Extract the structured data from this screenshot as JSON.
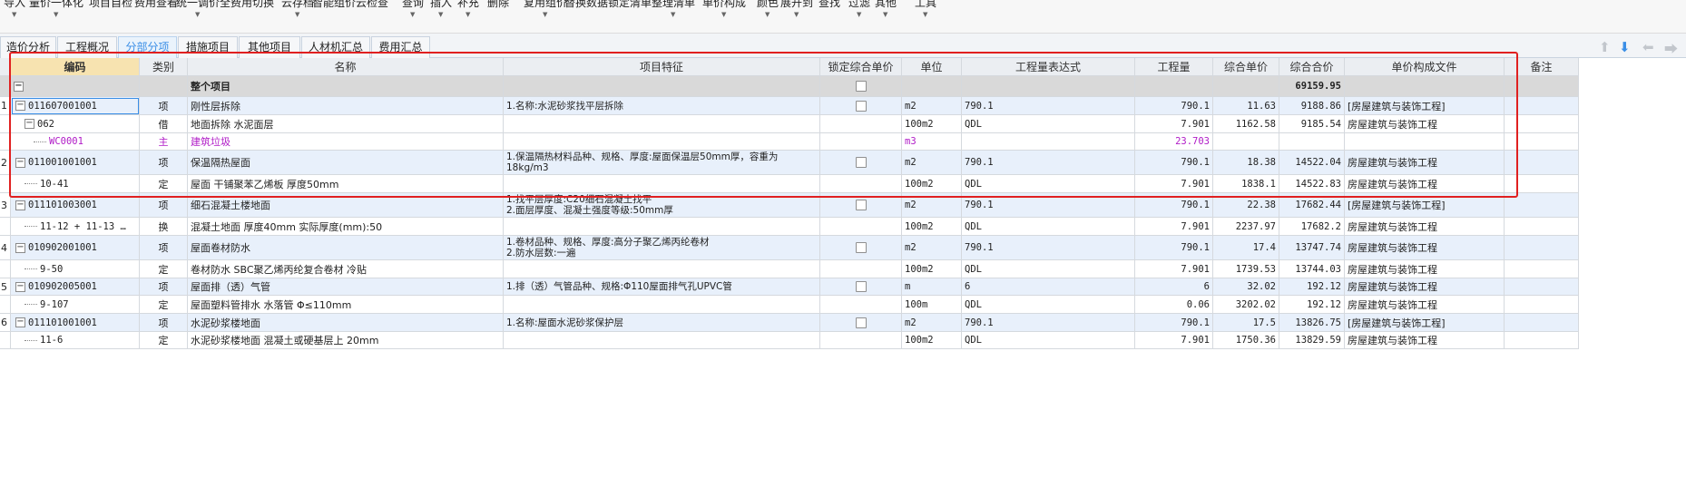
{
  "toolbar": [
    {
      "label": "导入",
      "arrow": true
    },
    {
      "label": "量价一体化",
      "arrow": true
    },
    {
      "label": "项目自检",
      "arrow": false
    },
    {
      "label": "费用查看",
      "arrow": false
    },
    {
      "label": "统一调价",
      "arrow": true
    },
    {
      "label": "全费用切换",
      "arrow": false
    },
    {
      "label": "云存档",
      "arrow": true
    },
    {
      "label": "智能组价",
      "arrow": false
    },
    {
      "label": "云检查",
      "arrow": false
    },
    {
      "label": "查询",
      "arrow": true
    },
    {
      "label": "插入",
      "arrow": true
    },
    {
      "label": "补充",
      "arrow": true
    },
    {
      "label": "删除",
      "arrow": false
    },
    {
      "label": "复用组价",
      "arrow": true
    },
    {
      "label": "替换数据",
      "arrow": false
    },
    {
      "label": "锁定清单",
      "arrow": false
    },
    {
      "label": "整理清单",
      "arrow": true
    },
    {
      "label": "单价构成",
      "arrow": true
    },
    {
      "label": "颜色",
      "arrow": true
    },
    {
      "label": "展开到",
      "arrow": true
    },
    {
      "label": "查找",
      "arrow": false
    },
    {
      "label": "过滤",
      "arrow": true
    },
    {
      "label": "其他",
      "arrow": true
    },
    {
      "label": "工具",
      "arrow": true
    }
  ],
  "tabs": [
    {
      "label": "造价分析",
      "active": false
    },
    {
      "label": "工程概况",
      "active": false
    },
    {
      "label": "分部分项",
      "active": true
    },
    {
      "label": "措施项目",
      "active": false
    },
    {
      "label": "其他项目",
      "active": false
    },
    {
      "label": "人材机汇总",
      "active": false
    },
    {
      "label": "费用汇总",
      "active": false
    }
  ],
  "nav_icons": [
    "arrow-up-icon",
    "arrow-down-icon",
    "arrow-left-icon",
    "arrow-right-icon"
  ],
  "columns": [
    "编码",
    "类别",
    "名称",
    "项目特征",
    "锁定综合单价",
    "单位",
    "工程量表达式",
    "工程量",
    "综合单价",
    "综合合价",
    "单价构成文件",
    "备注"
  ],
  "whole_project": {
    "name": "整个项目",
    "total": "69159.95"
  },
  "rows": [
    {
      "num": "1",
      "level": 0,
      "type": "q",
      "code": "011607001001",
      "category": "项",
      "name": "刚性层拆除",
      "features": [
        "1.名称:水泥砂浆找平层拆除"
      ],
      "lock": true,
      "unit": "m2",
      "expr": "790.1",
      "qty": "790.1",
      "unit_price": "11.63",
      "total": "9188.86",
      "file": "[房屋建筑与装饰工程]"
    },
    {
      "num": "",
      "level": 1,
      "type": "s",
      "code": "062",
      "category": "借",
      "name": "地面拆除 水泥面层",
      "features": [],
      "lock": false,
      "unit": "100m2",
      "expr": "QDL",
      "qty": "7.901",
      "unit_price": "1162.58",
      "total": "9185.54",
      "file": "房屋建筑与装饰工程"
    },
    {
      "num": "",
      "level": 2,
      "type": "m",
      "code": "WC0001",
      "category": "主",
      "name": "建筑垃圾",
      "features": [],
      "lock": false,
      "unit": "m3",
      "expr": "",
      "qty": "23.703",
      "unit_price": "",
      "total": "",
      "file": ""
    },
    {
      "num": "2",
      "level": 0,
      "type": "q",
      "code": "011001001001",
      "category": "项",
      "name": "保温隔热屋面",
      "features": [
        "1.保温隔热材料品种、规格、厚度:屋面保温层50mm厚，容重为18kg/m3"
      ],
      "lock": true,
      "unit": "m2",
      "expr": "790.1",
      "qty": "790.1",
      "unit_price": "18.38",
      "total": "14522.04",
      "file": "房屋建筑与装饰工程"
    },
    {
      "num": "",
      "level": 1,
      "type": "s",
      "code": "10-41",
      "category": "定",
      "name": "屋面 干铺聚苯乙烯板 厚度50mm",
      "features": [],
      "lock": false,
      "unit": "100m2",
      "expr": "QDL",
      "qty": "7.901",
      "unit_price": "1838.1",
      "total": "14522.83",
      "file": "房屋建筑与装饰工程"
    },
    {
      "num": "3",
      "level": 0,
      "type": "q",
      "code": "011101003001",
      "category": "项",
      "name": "细石混凝土楼地面",
      "features": [
        "1.找平层厚度:C20细石混凝土找平",
        "2.面层厚度、混凝土强度等级:50mm厚"
      ],
      "lock": true,
      "unit": "m2",
      "expr": "790.1",
      "qty": "790.1",
      "unit_price": "22.38",
      "total": "17682.44",
      "file": "[房屋建筑与装饰工程]"
    },
    {
      "num": "",
      "level": 1,
      "type": "s",
      "code": "11-12 + 11-13 …",
      "category": "换",
      "name": "混凝土地面 厚度40mm  实际厚度(mm):50",
      "features": [],
      "lock": false,
      "unit": "100m2",
      "expr": "QDL",
      "qty": "7.901",
      "unit_price": "2237.97",
      "total": "17682.2",
      "file": "房屋建筑与装饰工程"
    },
    {
      "num": "4",
      "level": 0,
      "type": "q",
      "code": "010902001001",
      "category": "项",
      "name": "屋面卷材防水",
      "features": [
        "1.卷材品种、规格、厚度:高分子聚乙烯丙纶卷材",
        "2.防水层数:一遍"
      ],
      "lock": true,
      "unit": "m2",
      "expr": "790.1",
      "qty": "790.1",
      "unit_price": "17.4",
      "total": "13747.74",
      "file": "房屋建筑与装饰工程"
    },
    {
      "num": "",
      "level": 1,
      "type": "s",
      "code": "9-50",
      "category": "定",
      "name": "卷材防水 SBC聚乙烯丙纶复合卷材 冷贴",
      "features": [],
      "lock": false,
      "unit": "100m2",
      "expr": "QDL",
      "qty": "7.901",
      "unit_price": "1739.53",
      "total": "13744.03",
      "file": "房屋建筑与装饰工程"
    },
    {
      "num": "5",
      "level": 0,
      "type": "q",
      "code": "010902005001",
      "category": "项",
      "name": "屋面排（透）气管",
      "features": [
        "1.排（透）气管品种、规格:Φ110屋面排气孔UPVC管"
      ],
      "lock": true,
      "unit": "m",
      "expr": "6",
      "qty": "6",
      "unit_price": "32.02",
      "total": "192.12",
      "file": "房屋建筑与装饰工程"
    },
    {
      "num": "",
      "level": 1,
      "type": "s",
      "code": "9-107",
      "category": "定",
      "name": "屋面塑料管排水 水落管 Φ≤110mm",
      "features": [],
      "lock": false,
      "unit": "100m",
      "expr": "QDL",
      "qty": "0.06",
      "unit_price": "3202.02",
      "total": "192.12",
      "file": "房屋建筑与装饰工程"
    },
    {
      "num": "6",
      "level": 0,
      "type": "q",
      "code": "011101001001",
      "category": "项",
      "name": "水泥砂浆楼地面",
      "features": [
        "1.名称:屋面水泥砂浆保护层"
      ],
      "lock": true,
      "unit": "m2",
      "expr": "790.1",
      "qty": "790.1",
      "unit_price": "17.5",
      "total": "13826.75",
      "file": "[房屋建筑与装饰工程]"
    },
    {
      "num": "",
      "level": 1,
      "type": "s",
      "code": "11-6",
      "category": "定",
      "name": "水泥砂浆楼地面 混凝土或硬基层上 20mm",
      "features": [],
      "lock": false,
      "unit": "100m2",
      "expr": "QDL",
      "qty": "7.901",
      "unit_price": "1750.36",
      "total": "13829.59",
      "file": "房屋建筑与装饰工程"
    }
  ]
}
